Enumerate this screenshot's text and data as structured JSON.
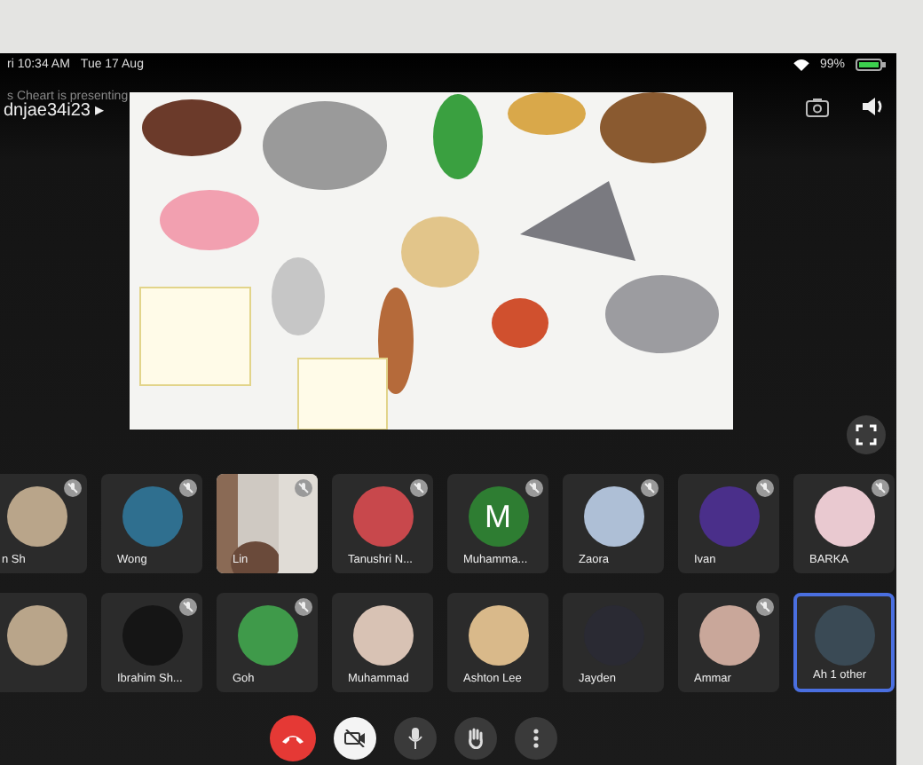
{
  "status_bar": {
    "time": "ri 10:34 AM",
    "date": "Tue 17 Aug",
    "battery": "99%"
  },
  "presenter": {
    "notice": "s Cheart is presenting",
    "meeting": "dnjae34i23 ▸"
  },
  "participants": [
    {
      "name": "n Sh",
      "color": "#b9a58a",
      "muted": true,
      "selected": false
    },
    {
      "name": "Wong",
      "color": "#2f6f8f",
      "muted": true,
      "selected": false
    },
    {
      "name": "Lin",
      "kind": "video",
      "muted": true,
      "selected": false
    },
    {
      "name": "Tanushri N...",
      "color": "#c8484c",
      "muted": true,
      "selected": false
    },
    {
      "name": "Muhamma...",
      "letter": "M",
      "color": "#2e7d32",
      "muted": true,
      "selected": false
    },
    {
      "name": "Zaora",
      "color": "#aebfd6",
      "muted": true,
      "selected": false
    },
    {
      "name": "Ivan",
      "color": "#4a2f8a",
      "muted": true,
      "selected": false
    },
    {
      "name": "BARKA",
      "color": "#e9c9d0",
      "muted": true,
      "selected": false
    },
    {
      "color": "#b9a58a",
      "muted": false,
      "selected": false
    },
    {
      "name": "Ibrahim Sh...",
      "color": "#151515",
      "muted": true,
      "selected": false
    },
    {
      "name": "Goh",
      "color": "#3f9a4a",
      "muted": true,
      "selected": false
    },
    {
      "name": "Muhammad",
      "color": "#d8c2b4",
      "muted": false,
      "selected": false
    },
    {
      "name": "Ashton Lee",
      "color": "#d9b98a",
      "muted": false,
      "selected": false
    },
    {
      "name": "Jayden",
      "color": "#2a2a33",
      "muted": false,
      "selected": false
    },
    {
      "name": "Ammar",
      "color": "#c9a79a",
      "muted": true,
      "selected": false
    },
    {
      "name": "Ah  1 other",
      "color": "#3a4a55",
      "muted": false,
      "selected": true
    }
  ]
}
